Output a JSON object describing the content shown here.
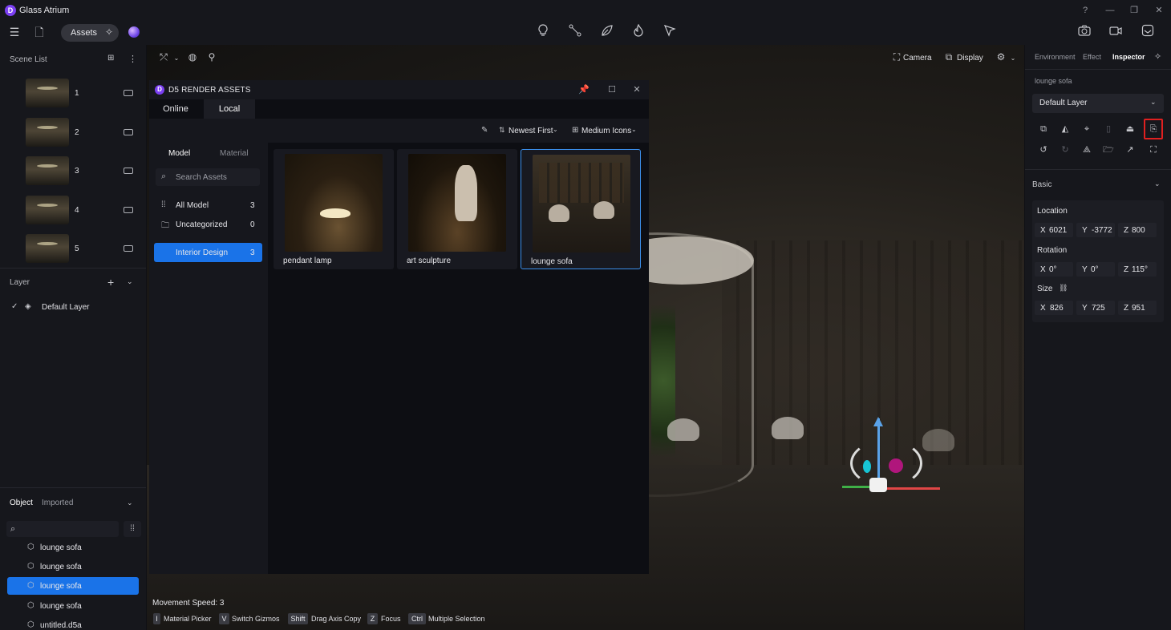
{
  "app": {
    "title": "Glass Atrium",
    "logo_letter": "D",
    "accent": "#1a73e8"
  },
  "window_controls": [
    "?",
    "—",
    "❐",
    "✕"
  ],
  "toolbar": {
    "menu_icon": "menu-icon",
    "file_icon": "file-icon",
    "assets_label": "Assets",
    "ai_icon": "sparkle-icon",
    "center_tools": [
      "light-bulb-icon",
      "path-icon",
      "leaf-icon",
      "fire-icon",
      "tag-icon"
    ],
    "right_tools": [
      "camera-icon",
      "video-icon",
      "inbox-icon"
    ]
  },
  "scene_list": {
    "title": "Scene List",
    "items": [
      {
        "num": "1"
      },
      {
        "num": "2"
      },
      {
        "num": "3"
      },
      {
        "num": "4"
      },
      {
        "num": "5"
      }
    ]
  },
  "layers": {
    "title": "Layer",
    "items": [
      {
        "label": "Default Layer"
      }
    ]
  },
  "objects": {
    "tabs": [
      "Object",
      "Imported"
    ],
    "items": [
      {
        "label": "lounge sofa",
        "selected": false
      },
      {
        "label": "lounge sofa",
        "selected": false
      },
      {
        "label": "lounge sofa",
        "selected": true
      },
      {
        "label": "lounge sofa",
        "selected": false
      },
      {
        "label": "untitled.d5a",
        "selected": false
      }
    ]
  },
  "viewport": {
    "camera_label": "Camera",
    "display_label": "Display"
  },
  "assets_dialog": {
    "title": "D5 RENDER ASSETS",
    "tabs": [
      "Online",
      "Local"
    ],
    "active_tab": "Local",
    "sort_label": "Newest First",
    "view_label": "Medium Icons",
    "subtabs": [
      "Model",
      "Material"
    ],
    "search_placeholder": "Search Assets",
    "categories": [
      {
        "label": "All Model",
        "count": "3"
      },
      {
        "label": "Uncategorized",
        "count": "0"
      },
      {
        "label": "Interior Design",
        "count": "3",
        "selected": true
      }
    ],
    "cards": [
      {
        "label": "pendant lamp",
        "selected": false
      },
      {
        "label": "art sculpture",
        "selected": false
      },
      {
        "label": "lounge sofa",
        "selected": true
      }
    ]
  },
  "inspector": {
    "tabs": [
      "Environment",
      "Effect",
      "Inspector"
    ],
    "active_tab": "Inspector",
    "object_name": "lounge sofa",
    "layer": "Default Layer",
    "section": "Basic",
    "location": {
      "title": "Location",
      "x": "6021",
      "y": "-3772",
      "z": "800"
    },
    "rotation": {
      "title": "Rotation",
      "x": "0°",
      "y": "0°",
      "z": "115°"
    },
    "size": {
      "title": "Size",
      "x": "826",
      "y": "725",
      "z": "951"
    }
  },
  "status": {
    "speed": "Movement Speed: 3",
    "shortcuts": [
      {
        "key": "I",
        "desc": "Material Picker"
      },
      {
        "key": "V",
        "desc": "Switch Gizmos"
      },
      {
        "key": "Shift",
        "desc": "Drag Axis Copy"
      },
      {
        "key": "Z",
        "desc": "Focus"
      },
      {
        "key": "Ctrl",
        "desc": "Multiple Selection"
      }
    ]
  }
}
